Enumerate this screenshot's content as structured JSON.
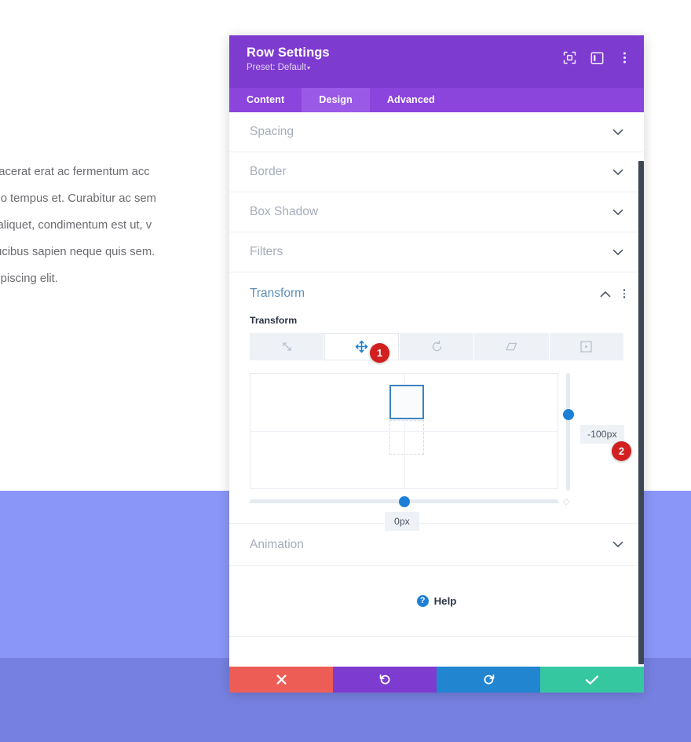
{
  "background": {
    "paragraphs": [
      "sapien. Donec placerat erat ac fermentum acc",
      "ni, eu congue odio tempus et. Curabitur ac sem",
      "lam vitae augue aliquet, condimentum est ut, v",
      "nar enim, nec faucibus sapien neque quis sem. ",
      "t, consectetur adipiscing elit."
    ],
    "section_color_light": "#8a96f8",
    "section_color_dark": "#7680e0"
  },
  "modal": {
    "title": "Row Settings",
    "preset": "Preset: Default",
    "preset_caret": "▾",
    "header_color": "#7E3BD0",
    "tabs_bar_color": "#8B44DC",
    "header_icons": [
      {
        "name": "focus-icon",
        "title": "Focus"
      },
      {
        "name": "layout-panel-icon",
        "title": "Layout"
      },
      {
        "name": "kebab-menu-icon",
        "title": "More options"
      }
    ],
    "tabs": [
      {
        "label": "Content",
        "active": false
      },
      {
        "label": "Design",
        "active": true
      },
      {
        "label": "Advanced",
        "active": false
      }
    ],
    "sections": [
      {
        "label": "Spacing",
        "open": false
      },
      {
        "label": "Border",
        "open": false
      },
      {
        "label": "Box Shadow",
        "open": false
      },
      {
        "label": "Filters",
        "open": false
      }
    ],
    "transform": {
      "section_label": "Transform",
      "section_color": "#5b8fb8",
      "field_label": "Transform",
      "modes": [
        {
          "name": "scale",
          "label": "Scale",
          "active": false
        },
        {
          "name": "translate",
          "label": "Translate",
          "active": true
        },
        {
          "name": "rotate",
          "label": "Rotate",
          "active": false
        },
        {
          "name": "skew",
          "label": "Skew",
          "active": false
        },
        {
          "name": "origin",
          "label": "Transform Origin",
          "active": false
        }
      ],
      "vertical_value": "-100px",
      "horizontal_value": "0px",
      "accent_color": "#1d7fd6",
      "box_border_color": "#3a83bf"
    },
    "animation_section": {
      "label": "Animation",
      "open": false
    },
    "help": {
      "label": "Help",
      "icon_glyph": "?"
    },
    "footer_buttons": [
      {
        "name": "cancel-button",
        "glyph": "close",
        "color": "#ED5D56"
      },
      {
        "name": "undo-button",
        "glyph": "undo",
        "color": "#7E3BD0"
      },
      {
        "name": "redo-button",
        "glyph": "redo",
        "color": "#2185D0"
      },
      {
        "name": "save-button",
        "glyph": "check",
        "color": "#35C8A0"
      }
    ]
  },
  "callouts": [
    {
      "number": "1"
    },
    {
      "number": "2"
    }
  ]
}
